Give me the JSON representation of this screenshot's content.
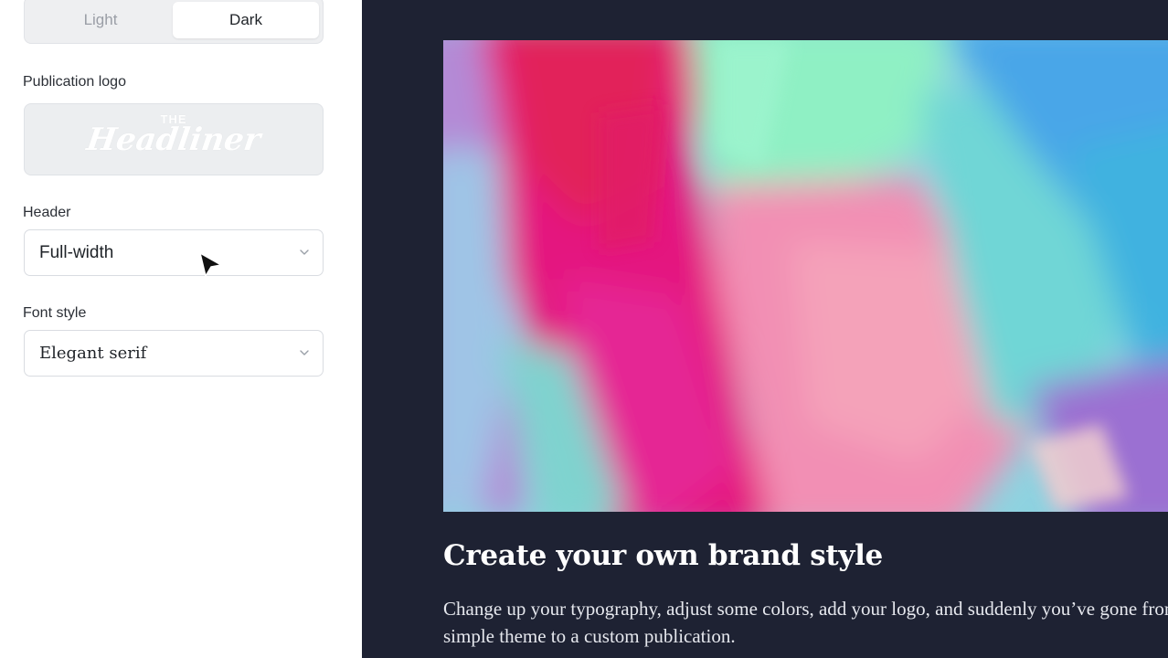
{
  "sidebar": {
    "theme_toggle": {
      "options": [
        "Light",
        "Dark"
      ],
      "selected": "Dark"
    },
    "publication_logo": {
      "label": "Publication logo",
      "logo_text_top": "THE",
      "logo_text_main": "Headliner"
    },
    "header": {
      "label": "Header",
      "value": "Full-width"
    },
    "font_style": {
      "label": "Font style",
      "value": "Elegant serif"
    }
  },
  "preview": {
    "background_color": "#1e2233",
    "hero_image": "abstract-painting",
    "title": "Create your own brand style",
    "body": "Change up your typography, adjust some colors, add your logo, and suddenly you’ve gone from a simple theme to a custom publication."
  },
  "icons": [
    "chevron-down-icon",
    "mouse-cursor-icon"
  ]
}
